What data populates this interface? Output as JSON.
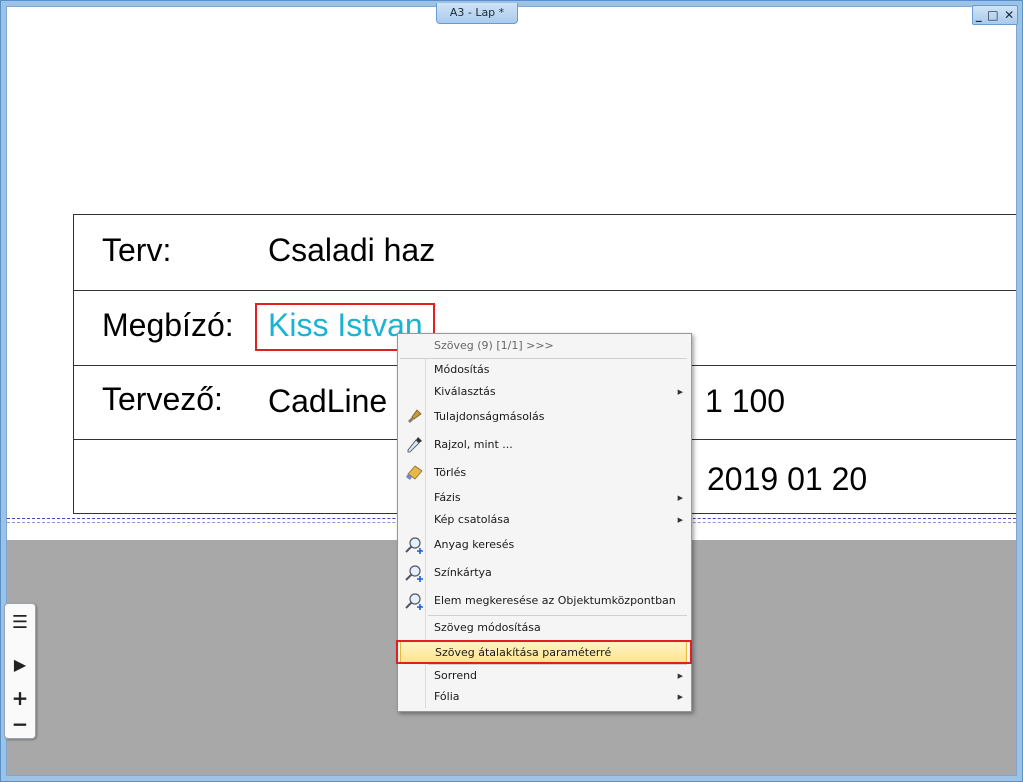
{
  "window": {
    "title": "A3 - Lap *",
    "controls": [
      "_",
      "□",
      "✕"
    ]
  },
  "drawing": {
    "rows": [
      {
        "label": "Terv:",
        "value": "Csaladi haz"
      },
      {
        "label": "Megbízó:",
        "value": "Kiss Istvan"
      },
      {
        "label": "Tervező:",
        "value": "CadLine",
        "extra": "1 100"
      },
      {
        "label": "",
        "value": "",
        "extra": "2019 01 20"
      }
    ],
    "value_color_selected": "#1ab3d4"
  },
  "toolbar": {
    "items": [
      {
        "icon": "list-icon",
        "glyph": "☰"
      },
      {
        "icon": "play-icon",
        "glyph": "▶"
      },
      {
        "icon": "plus-icon",
        "glyph": "+"
      },
      {
        "icon": "minus-icon",
        "glyph": "−"
      }
    ]
  },
  "context_menu": {
    "header": "Szöveg (9) [1/1] >>>",
    "items": [
      {
        "label": "Módosítás",
        "icon": "",
        "submenu": false
      },
      {
        "label": "Kiválasztás",
        "icon": "",
        "submenu": true
      },
      {
        "label": "Tulajdonságmásolás",
        "icon": "brush-icon",
        "submenu": false
      },
      {
        "label": "Rajzol, mint ...",
        "icon": "pipette-icon",
        "submenu": false
      },
      {
        "label": "Törlés",
        "icon": "eraser-icon",
        "submenu": false
      },
      {
        "label": "Fázis",
        "icon": "",
        "submenu": true
      },
      {
        "label": "Kép csatolása",
        "icon": "",
        "submenu": true
      },
      {
        "label": "Anyag keresés",
        "icon": "magnifier-plus-icon",
        "submenu": false
      },
      {
        "label": "Színkártya",
        "icon": "magnifier-plus-icon",
        "submenu": false
      },
      {
        "label": "Elem megkeresése az Objektumközpontban",
        "icon": "magnifier-plus-icon",
        "submenu": false
      },
      {
        "label": "Szöveg módosítása",
        "icon": "",
        "submenu": false
      },
      {
        "label": "Szöveg átalakítása paraméterré",
        "icon": "",
        "submenu": false,
        "highlighted": true
      },
      {
        "label": "Sorrend",
        "icon": "",
        "submenu": true
      },
      {
        "label": "Fólia",
        "icon": "",
        "submenu": true
      }
    ]
  }
}
